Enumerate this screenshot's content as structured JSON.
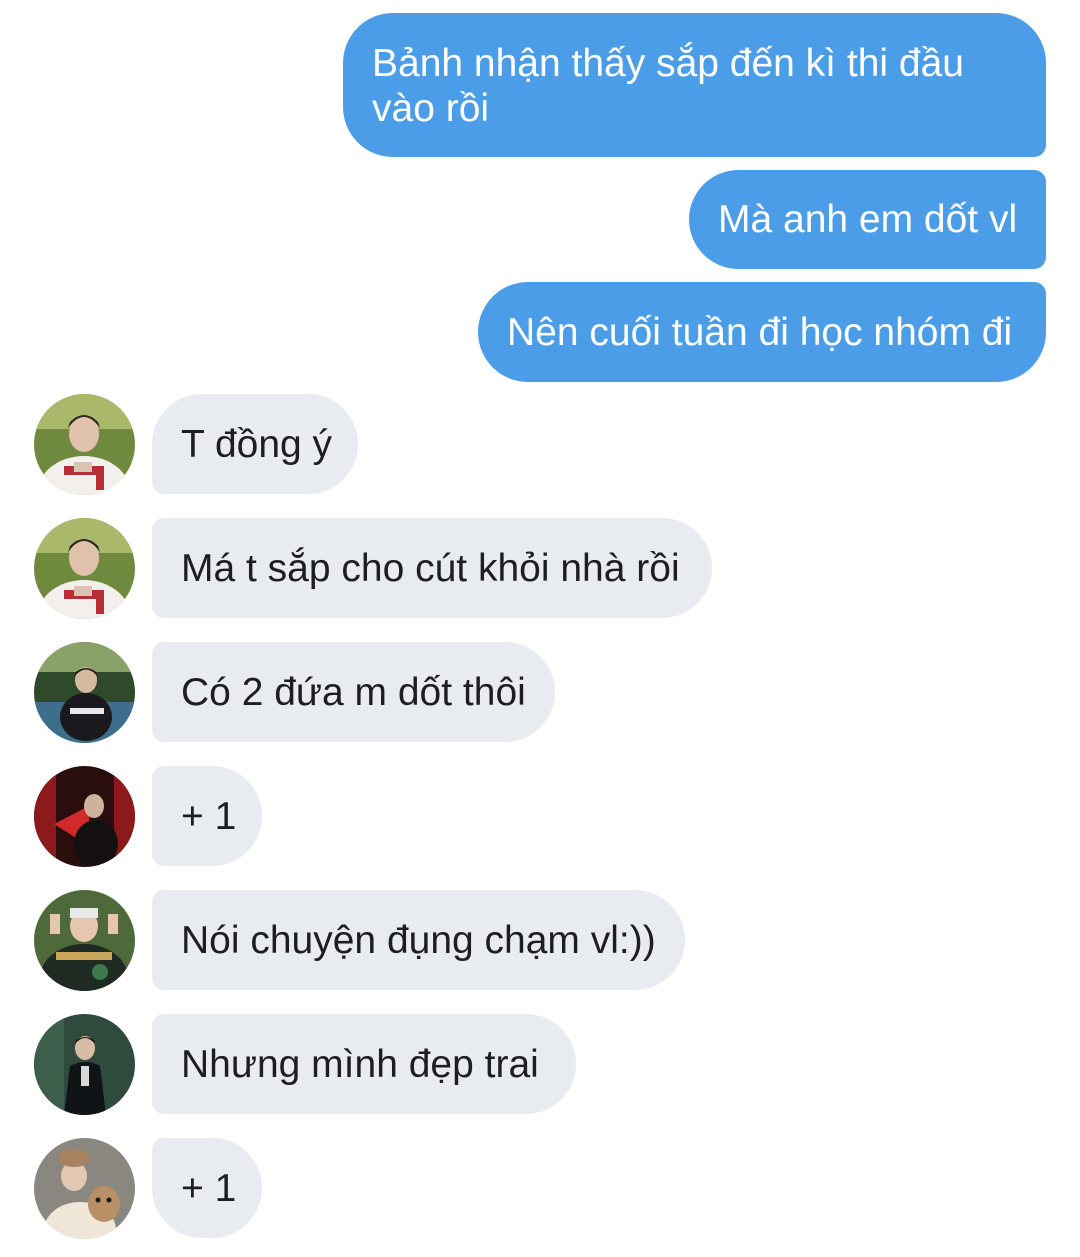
{
  "colors": {
    "outgoing_bubble": "#4c9de8",
    "incoming_bubble": "#e8ecf0",
    "background": "#ffffff"
  },
  "messages": {
    "outgoing": [
      {
        "text": "Bảnh nhận thấy sắp đến kì thi đầu vào rồi"
      },
      {
        "text": "Mà anh em dốt vl"
      },
      {
        "text": "Nên cuối tuần đi học nhóm đi"
      }
    ],
    "incoming": [
      {
        "text": "T đồng ý",
        "avatar": "user-avatar-baseball-jersey"
      },
      {
        "text": "Má t sắp cho cút khỏi nhà rồi",
        "avatar": "user-avatar-baseball-jersey"
      },
      {
        "text": "Có 2 đứa m dốt thôi",
        "avatar": "user-avatar-dark-outdoor"
      },
      {
        "text": "+ 1",
        "avatar": "user-avatar-red-fan"
      },
      {
        "text": "Nói chuyện đụng chạm vl:))",
        "avatar": "user-avatar-varsity-jacket"
      },
      {
        "text": "Nhưng mình đẹp trai",
        "avatar": "user-avatar-suit"
      },
      {
        "text": "+ 1",
        "avatar": "user-avatar-plush-toy"
      }
    ]
  }
}
